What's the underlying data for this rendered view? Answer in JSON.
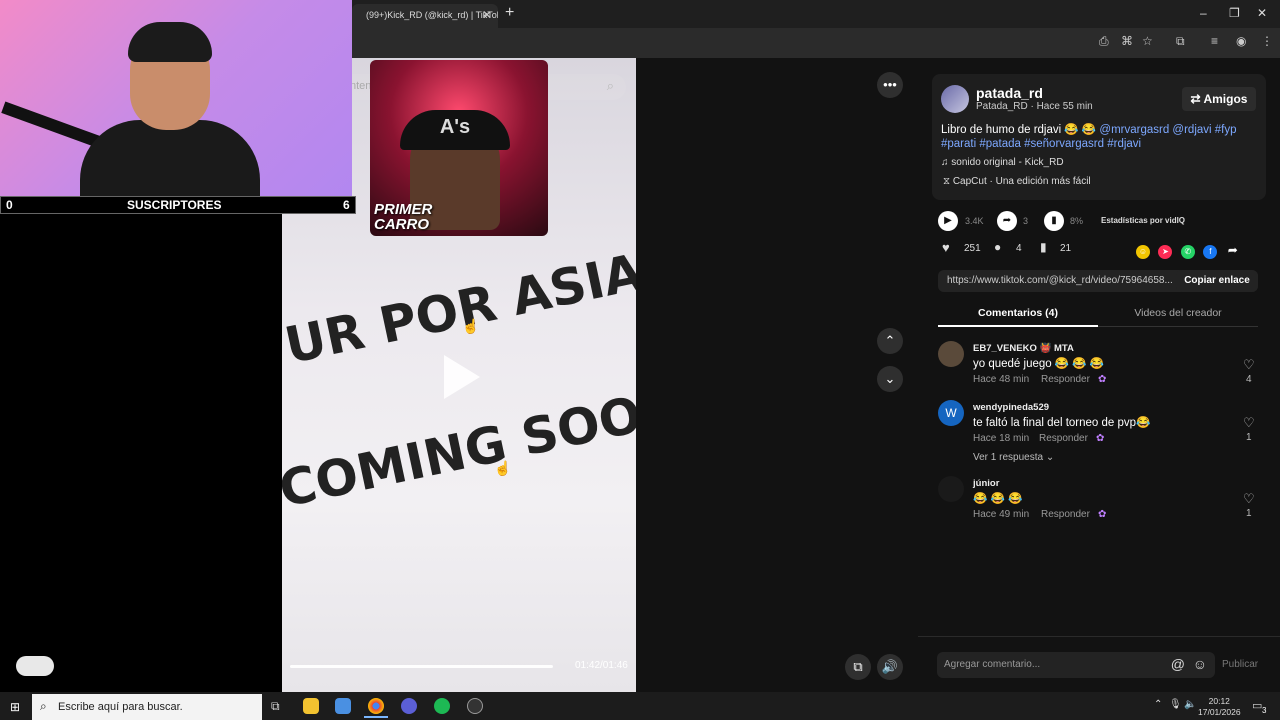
{
  "browser": {
    "tab_title": "(99+)Kick_RD (@kick_rd) | TikTok",
    "new_tab": "+",
    "window_controls": [
      "–",
      "❐",
      "✕"
    ]
  },
  "overlay": {
    "subs_left": "0",
    "subs_label": "SUSCRIPTORES",
    "subs_right": "6",
    "inset_caption_1": "PRIMER",
    "inset_caption_2": "CARRO",
    "inset_cap_logo": "A's"
  },
  "video": {
    "search_placeholder": "ntenido relacionado",
    "overlay_line_1": "UR POR ASIA",
    "overlay_line_2": "COMING SOO",
    "timecode": "01:42/01:46",
    "progress": 0.98
  },
  "post": {
    "username": "patada_rd",
    "subline": "Patada_RD · Hace 55 min",
    "friends_label": "Amigos",
    "description_text": "Libro de humo de rdjavi 😂 😂 ",
    "description_tags_line1": "@mrvargasrd @rdjavi #fyp",
    "description_tags_line2": "#parati #patada #señorvargasrd #rdjavi",
    "sound": "sonido original - Kick_RD",
    "capcut": "CapCut · Una edición más fácil",
    "stat_plays": "3.4K",
    "stat_shares_small": "3",
    "stat_pct": "8%",
    "stats_label": "Estadísticas por vidIQ",
    "likes": "251",
    "comments_count": "4",
    "saves": "21",
    "link": "https://www.tiktok.com/@kick_rd/video/75964658...",
    "copy_label": "Copiar enlace"
  },
  "tabs": {
    "comments": "Comentarios (4)",
    "creator_videos": "Videos del creador"
  },
  "comments": [
    {
      "name": "EB7_VENEKO 👹 MTA",
      "text": "yo quedé juego 😂 😂 😂",
      "time": "Hace 48 min",
      "reply": "Responder",
      "likes": "4",
      "avatar_color": "#5a4a3a"
    },
    {
      "name": "wendypineda529",
      "text": "te faltó la final del torneo de pvp😂",
      "time": "Hace 18 min",
      "reply": "Responder",
      "likes": "1",
      "avatar_letter": "W",
      "avatar_color": "#1565c0",
      "replies": "Ver 1 respuesta"
    },
    {
      "name": "júnior",
      "text": "😂 😂 😂",
      "time": "Hace 49 min",
      "reply": "Responder",
      "likes": "1",
      "avatar_color": "#1a1a1a"
    }
  ],
  "comment_box": {
    "placeholder": "Agregar comentario...",
    "publish": "Publicar"
  },
  "taskbar": {
    "search_placeholder": "Escribe aquí para buscar.",
    "time": "20:12",
    "date": "17/01/2026",
    "notif_count": "3"
  },
  "colors": {
    "accent_link": "#7da8ff",
    "bg": "#121212"
  }
}
